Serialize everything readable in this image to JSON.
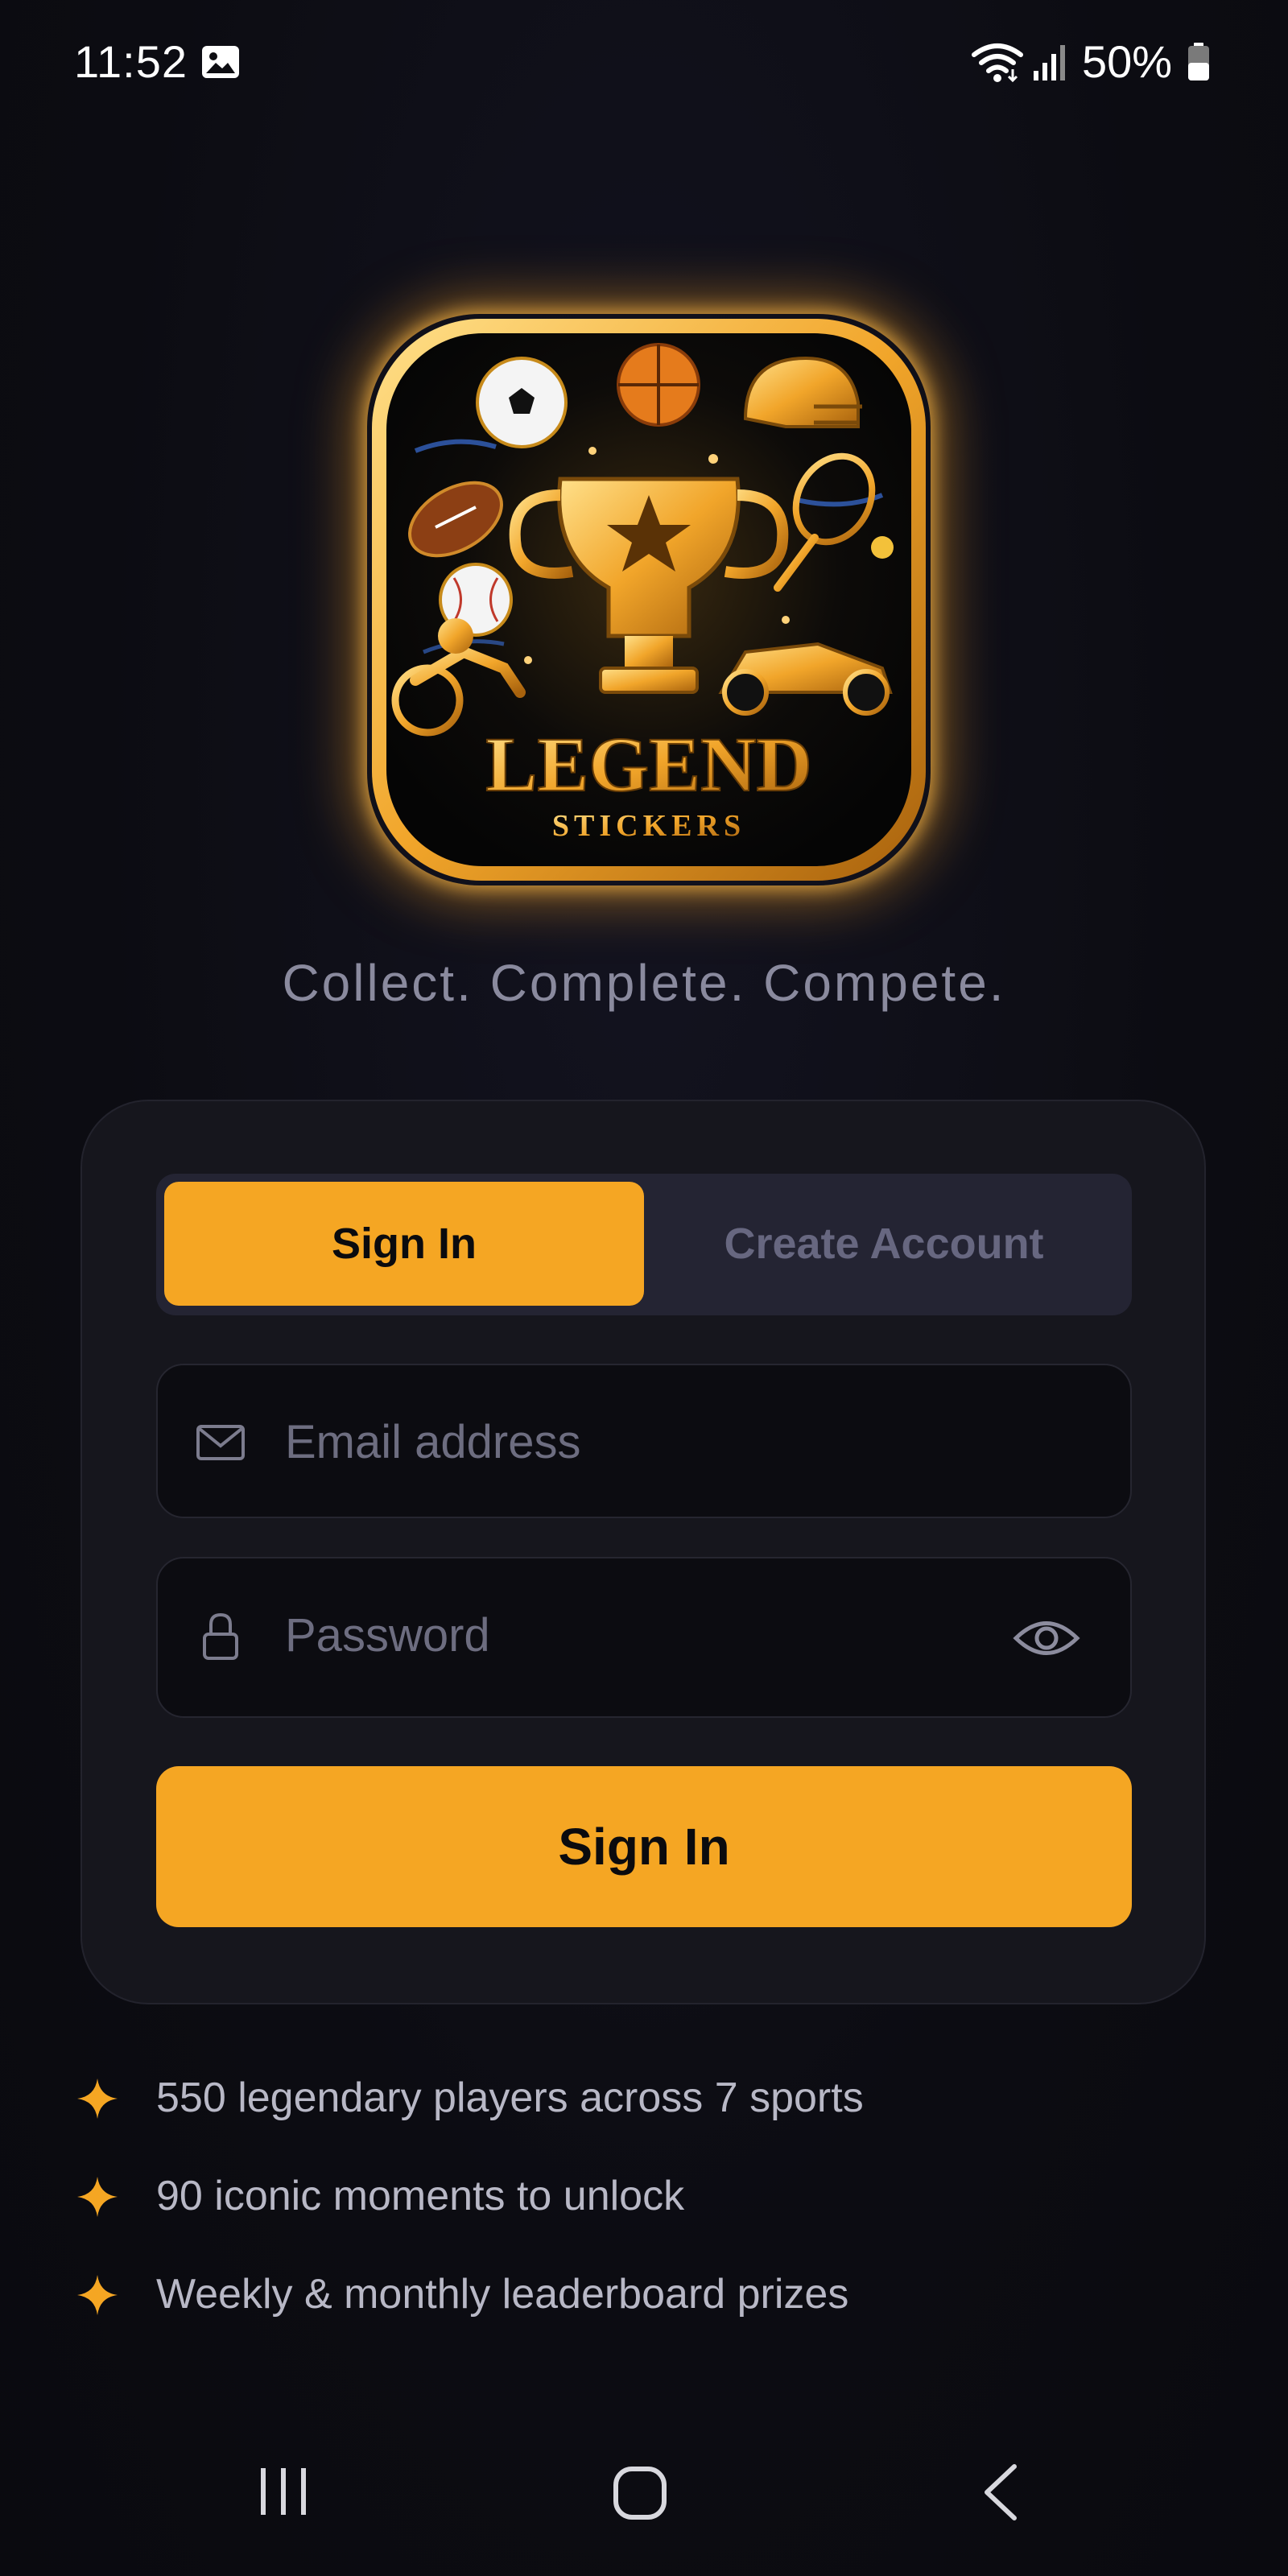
{
  "status_bar": {
    "time": "11:52",
    "battery": "50%",
    "icons": [
      "gallery-icon",
      "wifi-icon",
      "signal-icon",
      "battery-icon"
    ]
  },
  "logo": {
    "title": "LEGEND",
    "subtitle": "STICKERS"
  },
  "tagline": "Collect. Complete. Compete.",
  "auth": {
    "tabs": [
      {
        "label": "Sign In",
        "active": true
      },
      {
        "label": "Create Account",
        "active": false
      }
    ],
    "email": {
      "placeholder": "Email address",
      "value": "",
      "icon": "mail-icon"
    },
    "password": {
      "placeholder": "Password",
      "value": "",
      "icon": "lock-icon",
      "toggle_icon": "eye-icon"
    },
    "submit_label": "Sign In"
  },
  "features": [
    {
      "icon": "sparkle-icon",
      "text": "550 legendary players across 7 sports"
    },
    {
      "icon": "sparkle-icon",
      "text": "90 iconic moments to unlock"
    },
    {
      "icon": "sparkle-icon",
      "text": "Weekly & monthly leaderboard prizes"
    }
  ],
  "nav_bar": {
    "icons": [
      "recents-icon",
      "home-icon",
      "back-icon"
    ]
  },
  "colors": {
    "accent": "#f5a623",
    "background": "#0d0d12",
    "card": "#16161d",
    "muted_text": "#8a8a9e"
  }
}
